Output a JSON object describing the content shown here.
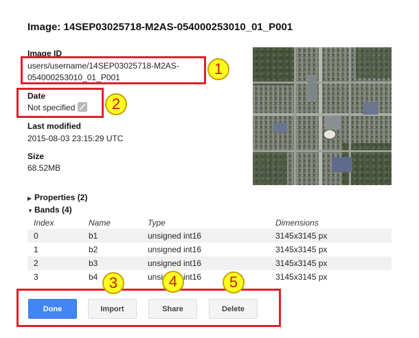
{
  "title": "Image: 14SEP03025718-M2AS-054000253010_01_P001",
  "image_id": {
    "label": "Image ID",
    "value_line1": "users/username/14SEP03025718-M2AS-",
    "value_line2": "054000253010_01_P001"
  },
  "date": {
    "label": "Date",
    "value": "Not specified",
    "edit_icon": "pencil-icon"
  },
  "last_modified": {
    "label": "Last modified",
    "value": "2015-08-03 23:15:29 UTC"
  },
  "size": {
    "label": "Size",
    "value": "68.52MB"
  },
  "properties": {
    "label": "Properties (2)",
    "expanded": false
  },
  "bands": {
    "label": "Bands (4)",
    "expanded": true,
    "columns": [
      "Index",
      "Name",
      "Type",
      "Dimensions"
    ],
    "rows": [
      [
        "0",
        "b1",
        "unsigned int16",
        "3145x3145 px"
      ],
      [
        "1",
        "b2",
        "unsigned int16",
        "3145x3145 px"
      ],
      [
        "2",
        "b3",
        "unsigned int16",
        "3145x3145 px"
      ],
      [
        "3",
        "b4",
        "unsigned int16",
        "3145x3145 px"
      ]
    ]
  },
  "buttons": {
    "done": "Done",
    "import": "Import",
    "share": "Share",
    "delete": "Delete"
  },
  "callouts": [
    "1",
    "2",
    "3",
    "4",
    "5"
  ],
  "colors": {
    "primary": "#4285f4",
    "annotation_red": "#e0202a",
    "callout_yellow": "#ffff22"
  }
}
